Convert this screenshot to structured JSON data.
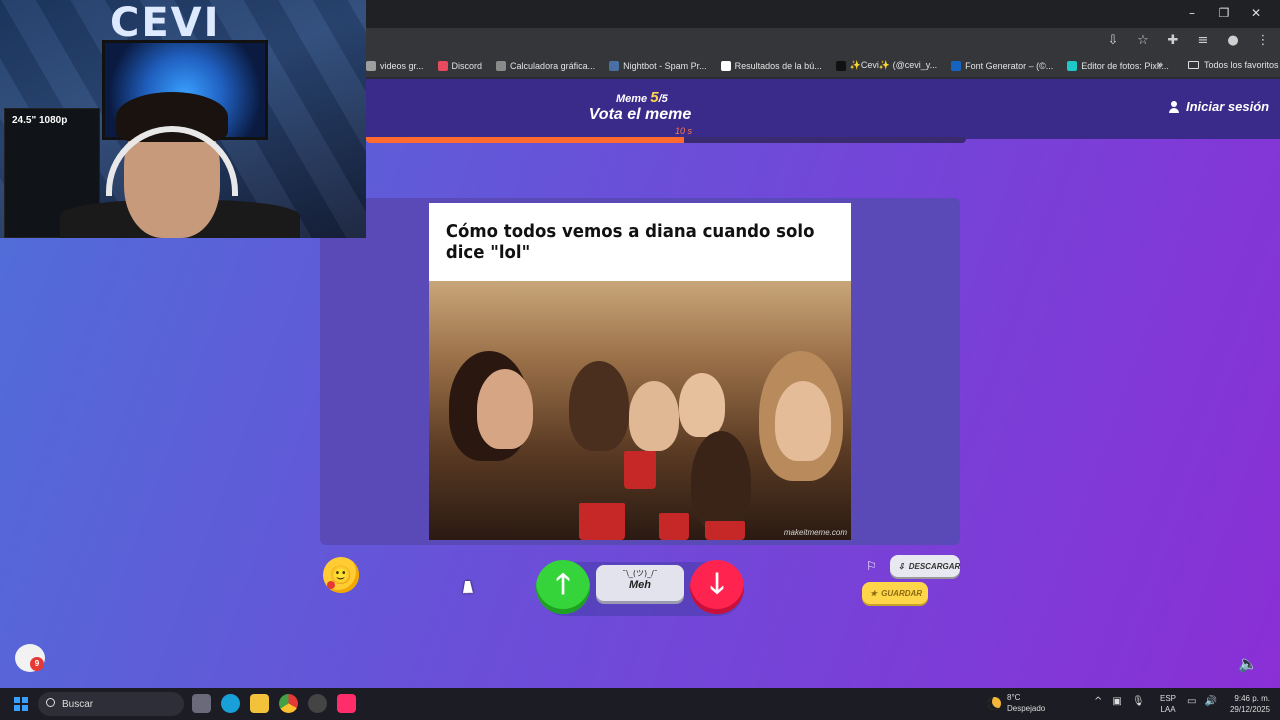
{
  "window": {
    "controls": [
      "–",
      "❐",
      "✕"
    ]
  },
  "bookmarks": [
    {
      "label": "videos gr...",
      "icon": "bookmark-icon",
      "color": "#9e9e9e"
    },
    {
      "label": "Discord",
      "icon": "discord-icon",
      "color": "#e84a5f"
    },
    {
      "label": "Calculadora gráfica...",
      "icon": "desmos-icon",
      "color": "#8a8a8a"
    },
    {
      "label": "Nightbot - Spam Pr...",
      "icon": "nightbot-icon",
      "color": "#4a6fa5"
    },
    {
      "label": "Resultados de la bú...",
      "icon": "document-icon",
      "color": "#ffffff"
    },
    {
      "label": "✨Cevi✨ (@cevi_y...",
      "icon": "tiktok-icon",
      "color": "#111111"
    },
    {
      "label": "Font Generator – (©...",
      "icon": "font-generator-icon",
      "color": "#1565c0"
    },
    {
      "label": "Editor de fotos: Pixlr...",
      "icon": "pixlr-icon",
      "color": "#1ec8c8"
    }
  ],
  "bookmarks_more": "»",
  "bookmarks_all": "Todos los favoritos",
  "header": {
    "meme_label": "Meme",
    "meme_current": "5",
    "meme_total": "/5",
    "title": "Vota el meme",
    "timer": "10 s",
    "progress": 0.53,
    "login": "Iniciar sesión"
  },
  "meme": {
    "caption": "Cómo todos vemos a diana cuando solo dice \"lol\"",
    "watermark": "makeitmeme.com"
  },
  "actions": {
    "up": "🡑",
    "down": "🡓",
    "meh_face": "¯\\_(ツ)_/¯",
    "meh_label": "Meh",
    "download": "DESCARGAR",
    "save": "GUARDAR",
    "chat_badge": "9",
    "emoji": "🙂"
  },
  "webcam": {
    "monitor_label": "24.5\" 1080p",
    "sign": "CEVI"
  },
  "taskbar": {
    "search": "Buscar",
    "weather_temp": "8°C",
    "weather_desc": "Despejado",
    "lang_1": "ESP",
    "lang_2": "LAA",
    "time": "9:46 p. m.",
    "date": "29/12/2025"
  },
  "colors": {
    "accent": "#ff6a30",
    "up": "#35d43a",
    "down": "#ff2450",
    "save": "#ffd54a"
  }
}
